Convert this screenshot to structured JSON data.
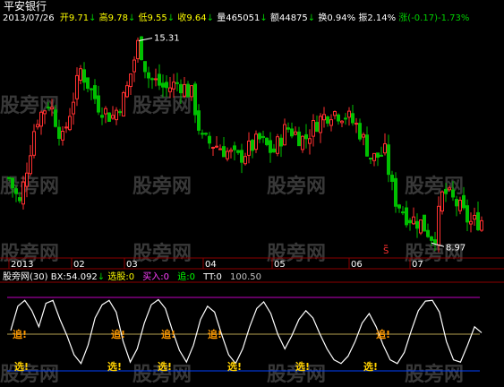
{
  "stock_name": "平安银行",
  "info_bar": {
    "date": "2013/07/26",
    "open": "开9.71",
    "high": "高9.78",
    "low": "低9.55",
    "close": "收9.64",
    "volume": "量465051",
    "amount": "额44875",
    "turnover": "换0.94%",
    "amplitude": "振2.14%",
    "change": "涨(-0.17)-1.73%"
  },
  "price_annotations": {
    "max": "15.31",
    "min": "8.97"
  },
  "time_axis": [
    "2013",
    "02",
    "03",
    "04",
    "05",
    "06",
    "07"
  ],
  "indicator_bar": {
    "name": "股旁网(30)",
    "bx": "BX:54.092",
    "xuangu": "选股:0",
    "mairu": "买入:0",
    "zhui": "追:0",
    "tt": "TT:0",
    "level": "100.50"
  },
  "signals": {
    "zhui": "追!",
    "xuan": "选!",
    "s_mark": "S"
  },
  "watermark": "股旁网",
  "colors": {
    "up": "#ff3030",
    "down": "#00c000",
    "grid": "#8b0000",
    "axis_text": "#ffffff",
    "purple_line": "#c000c0",
    "gold_line": "#b4a050",
    "blue_line": "#0040ff",
    "zhui_color": "#ff9900",
    "xuan_color": "#ffd000",
    "info_green": "#00d000",
    "info_yellow": "#ffff00"
  },
  "chart_data": [
    {
      "type": "candlestick",
      "x": [
        "2013-01",
        "2013-02",
        "2013-03",
        "2013-04",
        "2013-05",
        "2013-06",
        "2013-07"
      ],
      "ohlc": [
        [
          10.8,
          13.2,
          10.7,
          13.0
        ],
        [
          13.0,
          14.2,
          12.6,
          13.5
        ],
        [
          13.5,
          15.31,
          12.6,
          13.3
        ],
        [
          13.1,
          13.4,
          11.9,
          12.4
        ],
        [
          12.4,
          13.9,
          12.3,
          13.5
        ],
        [
          13.5,
          13.8,
          10.5,
          10.7
        ],
        [
          10.6,
          11.6,
          8.97,
          9.64
        ]
      ],
      "y_range": [
        8.5,
        15.8
      ]
    },
    {
      "type": "line",
      "name": "BX",
      "y": [
        55,
        88,
        96,
        82,
        60,
        92,
        96,
        70,
        48,
        22,
        10,
        35,
        72,
        90,
        96,
        80,
        40,
        12,
        30,
        65,
        90,
        97,
        85,
        55,
        28,
        12,
        35,
        70,
        88,
        80,
        50,
        22,
        10,
        30,
        60,
        85,
        94,
        78,
        50,
        30,
        48,
        70,
        82,
        72,
        50,
        30,
        15,
        10,
        20,
        40,
        65,
        78,
        60,
        35,
        15,
        10,
        25,
        55,
        82,
        95,
        96,
        80,
        40,
        15,
        12,
        35,
        60,
        52
      ],
      "ylim": [
        0,
        100
      ],
      "reference_levels": [
        100,
        50,
        0
      ]
    }
  ]
}
